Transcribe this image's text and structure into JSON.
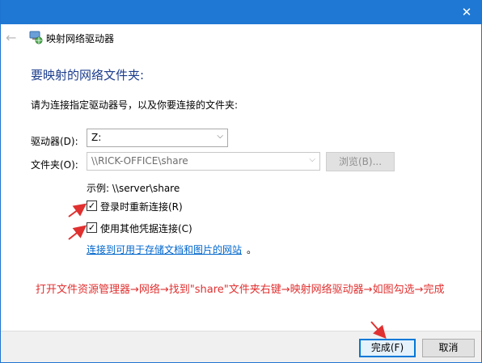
{
  "window": {
    "close_glyph": "✕"
  },
  "nav": {
    "title": "映射网络驱动器"
  },
  "form": {
    "heading": "要映射的网络文件夹:",
    "instruction": "请为连接指定驱动器号，以及你要连接的文件夹:",
    "drive_label": "驱动器(D):",
    "drive_value": "Z:",
    "folder_label": "文件夹(O):",
    "folder_value": "\\\\RICK-OFFICE\\share",
    "browse_label": "浏览(B)...",
    "example": "示例: \\\\server\\share",
    "reconnect_label": "登录时重新连接(R)",
    "reconnect_checked": true,
    "credentials_label": "使用其他凭据连接(C)",
    "credentials_checked": true,
    "link_text": "连接到可用于存储文档和图片的网站",
    "link_suffix": "。"
  },
  "annotation": {
    "note": "打开文件资源管理器→网络→找到\"share\"文件夹右键→映射网络驱动器→如图勾选→完成",
    "color": "#e03030"
  },
  "footer": {
    "finish_label": "完成(F)",
    "cancel_label": "取消"
  },
  "colors": {
    "titlebar": "#1e78d4",
    "heading": "#1c3d8c",
    "link": "#0066cc",
    "primary_button_border": "#0078d7"
  }
}
